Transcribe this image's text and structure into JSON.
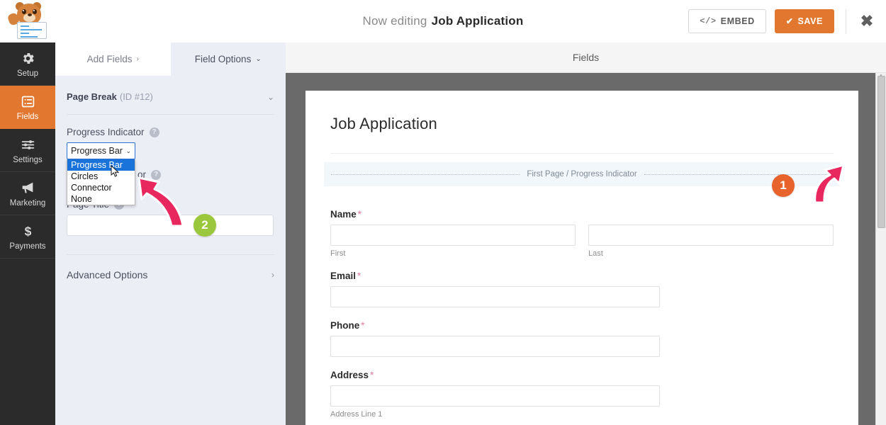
{
  "header": {
    "logo_name": "wpforms-mascot-logo",
    "editing_prefix": "Now editing",
    "form_name": "Job Application",
    "embed_label": "EMBED",
    "embed_icon": "code-icon",
    "save_label": "SAVE",
    "save_icon": "check-icon",
    "close_icon": "close-icon",
    "accent_orange": "#e27730"
  },
  "sidebar": {
    "items": [
      {
        "label": "Setup",
        "icon": "gear-icon",
        "active": false
      },
      {
        "label": "Fields",
        "icon": "list-icon",
        "active": true
      },
      {
        "label": "Settings",
        "icon": "sliders-icon",
        "active": false
      },
      {
        "label": "Marketing",
        "icon": "megaphone-icon",
        "active": false
      },
      {
        "label": "Payments",
        "icon": "dollar-icon",
        "active": false
      }
    ]
  },
  "panel": {
    "tabs": [
      {
        "label": "Add Fields",
        "chevron": "›",
        "active": false
      },
      {
        "label": "Field Options",
        "chevron": "⌄",
        "active": true
      }
    ],
    "field": {
      "title": "Page Break",
      "id_text": "(ID #12)",
      "collapse_icon": "chevron-down-icon"
    },
    "progress_indicator": {
      "label": "Progress Indicator",
      "help_icon": "help-icon",
      "selected": "Progress Bar",
      "options": [
        "Progress Bar",
        "Circles",
        "Connector",
        "None"
      ],
      "dropdown_open": true,
      "chevron": "⌄"
    },
    "obscured_label": {
      "text": "or",
      "help_icon": "help-icon"
    },
    "page_title": {
      "label": "Page Title",
      "help_icon": "help-icon",
      "value": "",
      "placeholder": ""
    },
    "advanced_options": {
      "label": "Advanced Options",
      "chevron": "›"
    }
  },
  "preview": {
    "subheader_title": "Fields",
    "form_title": "Job Application",
    "page_break_text": "First Page / Progress Indicator",
    "fields": [
      {
        "label": "Name",
        "required": "*",
        "type": "name",
        "sublabels": [
          "First",
          "Last"
        ]
      },
      {
        "label": "Email",
        "required": "*",
        "type": "text",
        "sublabels": []
      },
      {
        "label": "Phone",
        "required": "*",
        "type": "text",
        "sublabels": []
      },
      {
        "label": "Address",
        "required": "*",
        "type": "text",
        "sublabels": [
          "Address Line 1"
        ]
      }
    ]
  },
  "annotations": {
    "badge_1": {
      "text": "1",
      "color": "#e8622c"
    },
    "badge_2": {
      "text": "2",
      "color": "#9ac73b"
    },
    "arrow_color": "#e8275f",
    "arrow_1_name": "annotation-arrow-progress-indicator-preview",
    "arrow_2_name": "annotation-arrow-progress-indicator-dropdown"
  },
  "scrollbar": {
    "name": "preview-vertical-scrollbar"
  }
}
